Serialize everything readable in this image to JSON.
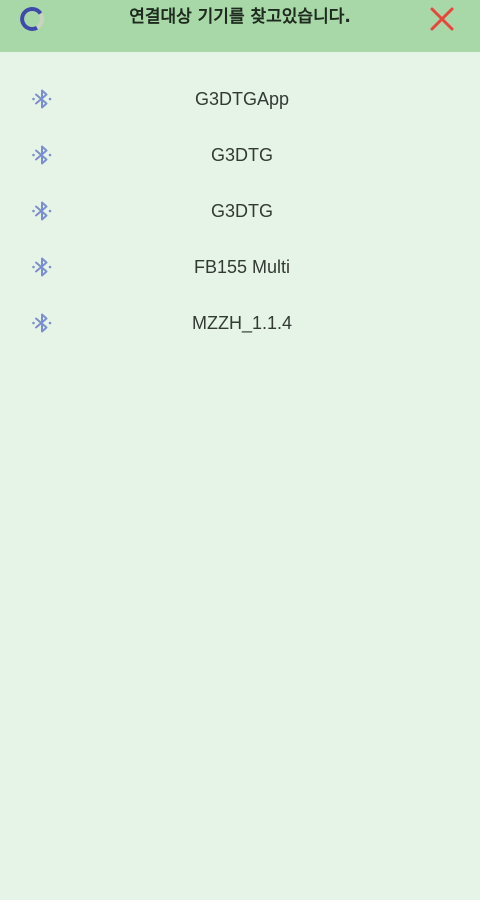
{
  "header": {
    "title": "연결대상 기기를 찾고있습니다.",
    "spinner_icon": "loading-spinner-icon",
    "close_icon": "close-icon",
    "close_color": "#e8453c",
    "spinner_color": "#3d4aa8"
  },
  "devices": [
    {
      "name": "G3DTGApp",
      "icon": "bluetooth-icon"
    },
    {
      "name": "G3DTG",
      "icon": "bluetooth-icon"
    },
    {
      "name": "G3DTG",
      "icon": "bluetooth-icon"
    },
    {
      "name": "FB155 Multi",
      "icon": "bluetooth-icon"
    },
    {
      "name": "MZZH_1.1.4",
      "icon": "bluetooth-icon"
    }
  ],
  "colors": {
    "header_bg": "#a8d8a8",
    "page_bg": "#e6f4e8",
    "bluetooth_icon": "#7b8fcf"
  }
}
